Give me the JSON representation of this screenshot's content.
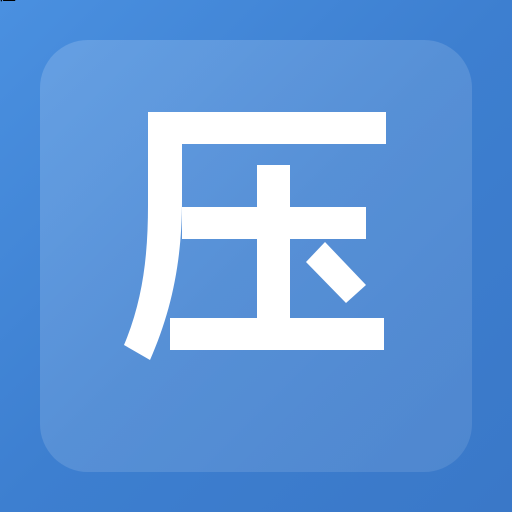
{
  "app_icon": {
    "glyph": "压",
    "colors": {
      "background": "#3f84d6",
      "tile_overlay": "rgba(255,255,255,0.14)",
      "glyph": "#ffffff"
    }
  }
}
